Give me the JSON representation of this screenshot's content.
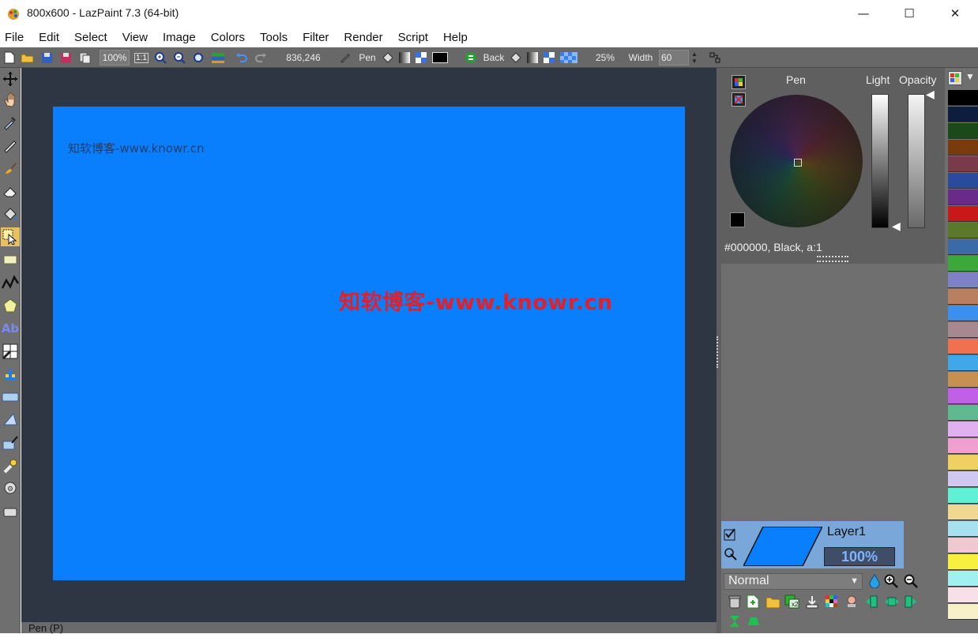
{
  "window": {
    "title": "800x600 - LazPaint 7.3 (64-bit)"
  },
  "window_controls": {
    "minimize": "—",
    "maximize": "☐",
    "close": "✕"
  },
  "menu": [
    "File",
    "Edit",
    "Select",
    "View",
    "Image",
    "Colors",
    "Tools",
    "Filter",
    "Render",
    "Script",
    "Help"
  ],
  "toolbar": {
    "zoom": "100%",
    "actual_size": "1:1",
    "cursor_pos": "836,246",
    "pen_label": "Pen",
    "back_label": "Back",
    "percent": "25%",
    "width_label": "Width",
    "width_value": "60"
  },
  "canvas": {
    "color": "#0a7ffe",
    "watermark_small": "知软博客-www.knowr.cn",
    "watermark_big": "知软博客-www.knowr.cn"
  },
  "status": {
    "text": "Pen (P)"
  },
  "color_panel": {
    "pen_label": "Pen",
    "light_label": "Light",
    "opacity_label": "Opacity",
    "color_info": "#000000, Black, a:1"
  },
  "layer": {
    "name": "Layer1",
    "opacity": "100%",
    "blend_mode": "Normal",
    "thumb_color": "#0a7ffe"
  },
  "palette": [
    "#000000",
    "#0d1d3d",
    "#1a4a1a",
    "#7a3a0a",
    "#7a3a4a",
    "#2a4aa0",
    "#6a2a8a",
    "#c81818",
    "#5a7a2a",
    "#3a6aa8",
    "#3aa83a",
    "#8080c8",
    "#b88060",
    "#3a90ee",
    "#a88890",
    "#f07050",
    "#40a8e8",
    "#c89050",
    "#c060e8",
    "#60b890",
    "#e0b0f0",
    "#f0a0d0",
    "#f0d060",
    "#d0c8f0",
    "#60f0d8",
    "#f0d890",
    "#a8e0f0",
    "#f0c8d0",
    "#f8f040",
    "#a0f0f0",
    "#f8e0e8",
    "#f8f0c8"
  ]
}
